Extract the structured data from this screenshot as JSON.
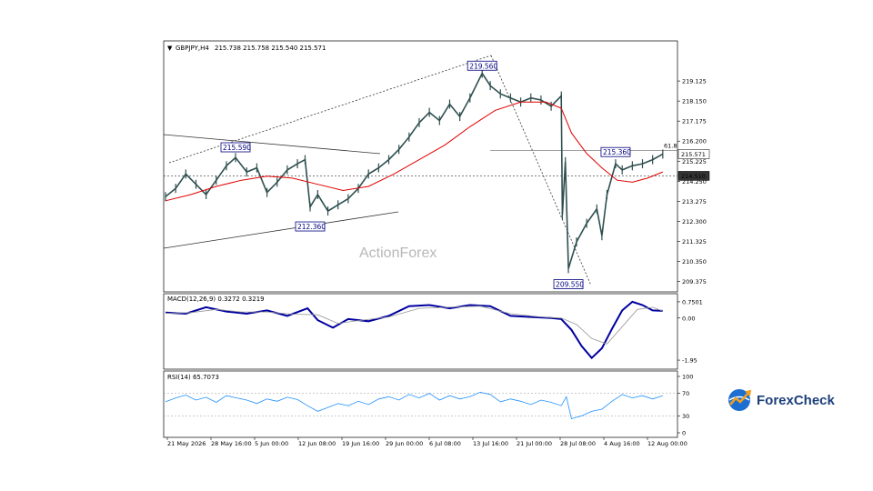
{
  "header": {
    "symbol": "GBPJPY,H4",
    "ohlc": "215.738 215.758 215.540 215.571"
  },
  "watermark": "ActionForex",
  "logo": {
    "text": "ForexCheck"
  },
  "colors": {
    "price": "#2f4f4f",
    "ma": "#e00000",
    "macd": "#0000a0",
    "rsi": "#1e90ff",
    "box": "#000080"
  },
  "chart_data": [
    {
      "type": "line",
      "panel": "price",
      "ylim": [
        209.0,
        220.5
      ],
      "y_ticks": [
        "219.125",
        "218.150",
        "217.175",
        "216.200",
        "215.225",
        "214.250",
        "213.275",
        "212.300",
        "211.325",
        "210.350",
        "209.375"
      ],
      "current_price": "215.571",
      "level_price": "214.510",
      "fib_label": "61.8",
      "annotations": [
        {
          "text": "219.560",
          "t": 0.624,
          "value": 219.56
        },
        {
          "text": "215.590",
          "t": 0.138,
          "value": 215.59
        },
        {
          "text": "212.360",
          "t": 0.285,
          "value": 212.36
        },
        {
          "text": "215.360",
          "t": 0.887,
          "value": 215.36
        },
        {
          "text": "209.550",
          "t": 0.794,
          "value": 209.55
        }
      ],
      "x_ticks": [
        "21 May 2026",
        "28 May 16:00",
        "5 Jun 00:00",
        "12 Jun 08:00",
        "19 Jun 16:00",
        "29 Jun 00:00",
        "6 Jul 08:00",
        "13 Jul 16:00",
        "21 Jul 00:00",
        "28 Jul 08:00",
        "4 Aug 16:00",
        "12 Aug 00:00"
      ],
      "series": [
        {
          "role": "close",
          "points": [
            [
              0.0,
              213.5
            ],
            [
              0.02,
              213.9
            ],
            [
              0.04,
              214.6
            ],
            [
              0.06,
              214.1
            ],
            [
              0.08,
              213.6
            ],
            [
              0.1,
              214.3
            ],
            [
              0.12,
              215.0
            ],
            [
              0.138,
              215.4
            ],
            [
              0.16,
              214.7
            ],
            [
              0.18,
              214.9
            ],
            [
              0.2,
              213.7
            ],
            [
              0.22,
              214.2
            ],
            [
              0.24,
              214.8
            ],
            [
              0.26,
              215.1
            ],
            [
              0.275,
              215.3
            ],
            [
              0.285,
              213.0
            ],
            [
              0.3,
              213.6
            ],
            [
              0.32,
              212.8
            ],
            [
              0.34,
              213.1
            ],
            [
              0.36,
              213.4
            ],
            [
              0.38,
              213.9
            ],
            [
              0.4,
              214.6
            ],
            [
              0.42,
              214.9
            ],
            [
              0.44,
              215.3
            ],
            [
              0.46,
              215.8
            ],
            [
              0.48,
              216.4
            ],
            [
              0.5,
              217.1
            ],
            [
              0.52,
              217.6
            ],
            [
              0.54,
              217.2
            ],
            [
              0.56,
              218.0
            ],
            [
              0.58,
              217.4
            ],
            [
              0.6,
              218.3
            ],
            [
              0.624,
              219.5
            ],
            [
              0.64,
              218.9
            ],
            [
              0.66,
              218.5
            ],
            [
              0.68,
              218.3
            ],
            [
              0.7,
              218.1
            ],
            [
              0.72,
              218.3
            ],
            [
              0.74,
              218.2
            ],
            [
              0.76,
              217.9
            ],
            [
              0.78,
              218.4
            ],
            [
              0.782,
              212.6
            ],
            [
              0.788,
              215.2
            ],
            [
              0.794,
              210.0
            ],
            [
              0.81,
              211.3
            ],
            [
              0.83,
              212.2
            ],
            [
              0.85,
              212.9
            ],
            [
              0.86,
              211.6
            ],
            [
              0.87,
              213.6
            ],
            [
              0.887,
              215.1
            ],
            [
              0.9,
              214.8
            ],
            [
              0.92,
              215.0
            ],
            [
              0.94,
              215.1
            ],
            [
              0.96,
              215.3
            ],
            [
              0.98,
              215.571
            ]
          ]
        },
        {
          "role": "ma",
          "points": [
            [
              0.0,
              213.3
            ],
            [
              0.05,
              213.6
            ],
            [
              0.1,
              214.0
            ],
            [
              0.15,
              214.3
            ],
            [
              0.2,
              214.5
            ],
            [
              0.25,
              214.4
            ],
            [
              0.3,
              214.1
            ],
            [
              0.35,
              213.8
            ],
            [
              0.4,
              214.0
            ],
            [
              0.45,
              214.6
            ],
            [
              0.5,
              215.3
            ],
            [
              0.55,
              216.0
            ],
            [
              0.6,
              216.9
            ],
            [
              0.65,
              217.7
            ],
            [
              0.7,
              218.1
            ],
            [
              0.75,
              218.1
            ],
            [
              0.78,
              217.8
            ],
            [
              0.8,
              216.6
            ],
            [
              0.83,
              215.6
            ],
            [
              0.86,
              214.9
            ],
            [
              0.89,
              214.3
            ],
            [
              0.92,
              214.2
            ],
            [
              0.95,
              214.4
            ],
            [
              0.98,
              214.7
            ]
          ]
        }
      ]
    },
    {
      "type": "line",
      "panel": "macd",
      "title": "MACD(12,26,9) 0.3272 0.3219",
      "ylim": [
        -2.2,
        1.0
      ],
      "y_ticks": [
        "0.7501",
        "0.00",
        "-1.95"
      ],
      "series": [
        {
          "role": "macd",
          "points": [
            [
              0.0,
              0.25
            ],
            [
              0.04,
              0.2
            ],
            [
              0.08,
              0.5
            ],
            [
              0.12,
              0.3
            ],
            [
              0.16,
              0.2
            ],
            [
              0.2,
              0.35
            ],
            [
              0.24,
              0.1
            ],
            [
              0.28,
              0.45
            ],
            [
              0.3,
              -0.1
            ],
            [
              0.33,
              -0.45
            ],
            [
              0.36,
              -0.05
            ],
            [
              0.4,
              -0.15
            ],
            [
              0.44,
              0.1
            ],
            [
              0.48,
              0.55
            ],
            [
              0.52,
              0.6
            ],
            [
              0.56,
              0.45
            ],
            [
              0.6,
              0.6
            ],
            [
              0.64,
              0.55
            ],
            [
              0.68,
              0.1
            ],
            [
              0.72,
              0.05
            ],
            [
              0.76,
              0.0
            ],
            [
              0.78,
              -0.05
            ],
            [
              0.8,
              -0.55
            ],
            [
              0.82,
              -1.3
            ],
            [
              0.84,
              -1.85
            ],
            [
              0.86,
              -1.4
            ],
            [
              0.88,
              -0.5
            ],
            [
              0.9,
              0.35
            ],
            [
              0.92,
              0.75
            ],
            [
              0.94,
              0.6
            ],
            [
              0.96,
              0.35
            ],
            [
              0.98,
              0.33
            ]
          ]
        },
        {
          "role": "signal",
          "points": [
            [
              0.0,
              0.22
            ],
            [
              0.05,
              0.25
            ],
            [
              0.1,
              0.4
            ],
            [
              0.15,
              0.28
            ],
            [
              0.2,
              0.28
            ],
            [
              0.25,
              0.18
            ],
            [
              0.3,
              0.15
            ],
            [
              0.34,
              -0.25
            ],
            [
              0.38,
              -0.12
            ],
            [
              0.44,
              0.05
            ],
            [
              0.5,
              0.45
            ],
            [
              0.56,
              0.5
            ],
            [
              0.62,
              0.55
            ],
            [
              0.68,
              0.2
            ],
            [
              0.74,
              0.05
            ],
            [
              0.78,
              0.0
            ],
            [
              0.81,
              -0.3
            ],
            [
              0.84,
              -0.95
            ],
            [
              0.87,
              -1.2
            ],
            [
              0.9,
              -0.4
            ],
            [
              0.93,
              0.4
            ],
            [
              0.96,
              0.5
            ],
            [
              0.98,
              0.32
            ]
          ]
        }
      ]
    },
    {
      "type": "line",
      "panel": "rsi",
      "title": "RSI(14) 65.7073",
      "ylim": [
        0,
        100
      ],
      "y_ticks": [
        "100",
        "70",
        "30",
        "0"
      ],
      "series": [
        {
          "role": "rsi",
          "points": [
            [
              0.0,
              55
            ],
            [
              0.02,
              62
            ],
            [
              0.04,
              67
            ],
            [
              0.06,
              58
            ],
            [
              0.08,
              63
            ],
            [
              0.1,
              54
            ],
            [
              0.12,
              66
            ],
            [
              0.14,
              62
            ],
            [
              0.16,
              58
            ],
            [
              0.18,
              52
            ],
            [
              0.2,
              60
            ],
            [
              0.22,
              56
            ],
            [
              0.24,
              63
            ],
            [
              0.26,
              59
            ],
            [
              0.28,
              48
            ],
            [
              0.3,
              38
            ],
            [
              0.32,
              45
            ],
            [
              0.34,
              52
            ],
            [
              0.36,
              48
            ],
            [
              0.38,
              56
            ],
            [
              0.4,
              50
            ],
            [
              0.42,
              60
            ],
            [
              0.44,
              64
            ],
            [
              0.46,
              58
            ],
            [
              0.48,
              68
            ],
            [
              0.5,
              62
            ],
            [
              0.52,
              70
            ],
            [
              0.54,
              58
            ],
            [
              0.56,
              66
            ],
            [
              0.58,
              60
            ],
            [
              0.6,
              64
            ],
            [
              0.62,
              72
            ],
            [
              0.64,
              68
            ],
            [
              0.66,
              55
            ],
            [
              0.68,
              60
            ],
            [
              0.7,
              56
            ],
            [
              0.72,
              50
            ],
            [
              0.74,
              58
            ],
            [
              0.76,
              54
            ],
            [
              0.78,
              48
            ],
            [
              0.79,
              64
            ],
            [
              0.8,
              25
            ],
            [
              0.82,
              30
            ],
            [
              0.84,
              38
            ],
            [
              0.86,
              42
            ],
            [
              0.88,
              56
            ],
            [
              0.9,
              68
            ],
            [
              0.92,
              62
            ],
            [
              0.94,
              66
            ],
            [
              0.96,
              60
            ],
            [
              0.98,
              66
            ]
          ]
        }
      ]
    }
  ]
}
